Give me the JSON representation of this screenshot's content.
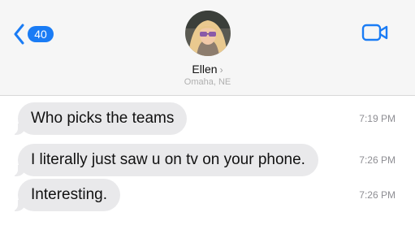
{
  "header": {
    "back_count": "40",
    "contact_name": "Ellen",
    "contact_location": "Omaha, NE"
  },
  "messages": [
    {
      "text": "Who picks the teams",
      "time": "7:19 PM"
    },
    {
      "text": "I literally just saw u on tv on your phone.",
      "time": "7:26 PM"
    },
    {
      "text": "Interesting.",
      "time": "7:26 PM"
    }
  ],
  "colors": {
    "accent": "#1a7cf5",
    "bubble_incoming": "#e9e9eb",
    "header_bg": "#f6f6f6",
    "timestamp": "#8e8e93"
  },
  "icons": [
    "chevron-left-icon",
    "chevron-right-icon",
    "video-camera-icon"
  ]
}
